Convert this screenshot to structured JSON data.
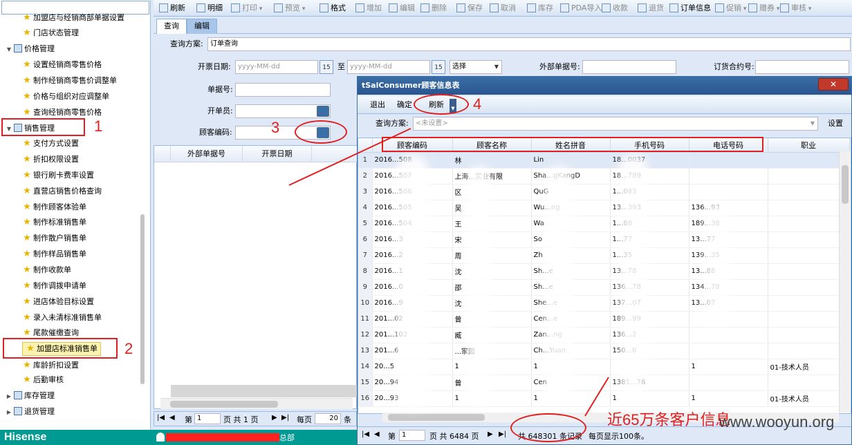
{
  "left_tree": {
    "items": [
      {
        "label": "加盟店与经销商部单据设置",
        "type": "star",
        "indent": 2
      },
      {
        "label": "门店状态管理",
        "type": "star",
        "indent": 2
      },
      {
        "label": "价格管理",
        "type": "group",
        "indent": 1
      },
      {
        "label": "设置经销商零售价格",
        "type": "star",
        "indent": 2
      },
      {
        "label": "制作经销商零售价调整单",
        "type": "star",
        "indent": 2
      },
      {
        "label": "价格与组织对应调整单",
        "type": "star",
        "indent": 2
      },
      {
        "label": "查询经销商零售价格",
        "type": "star",
        "indent": 2
      },
      {
        "label": "销售管理",
        "type": "group",
        "indent": 1
      },
      {
        "label": "支付方式设置",
        "type": "star",
        "indent": 2
      },
      {
        "label": "折扣权限设置",
        "type": "star",
        "indent": 2
      },
      {
        "label": "银行刷卡费率设置",
        "type": "star",
        "indent": 2
      },
      {
        "label": "直营店销售价格查询",
        "type": "star",
        "indent": 2
      },
      {
        "label": "制作顾客体验单",
        "type": "star",
        "indent": 2
      },
      {
        "label": "制作标准销售单",
        "type": "star",
        "indent": 2
      },
      {
        "label": "制作散户销售单",
        "type": "star",
        "indent": 2
      },
      {
        "label": "制作样品销售单",
        "type": "star",
        "indent": 2
      },
      {
        "label": "制作收款单",
        "type": "star",
        "indent": 2
      },
      {
        "label": "制作调拨申请单",
        "type": "star",
        "indent": 2
      },
      {
        "label": "进店体验目标设置",
        "type": "star",
        "indent": 2
      },
      {
        "label": "录入未清标准销售单",
        "type": "star",
        "indent": 2
      },
      {
        "label": "尾款催缴查询",
        "type": "star",
        "indent": 2
      },
      {
        "label": "加盟店标准销售单",
        "type": "star",
        "indent": 2,
        "selected": true
      },
      {
        "label": "库龄折扣设置",
        "type": "star",
        "indent": 2
      },
      {
        "label": "后勤审核",
        "type": "star",
        "indent": 2
      },
      {
        "label": "库存管理",
        "type": "group",
        "indent": 1,
        "collapsed": true
      },
      {
        "label": "退货管理",
        "type": "group",
        "indent": 1,
        "collapsed": true
      }
    ]
  },
  "brand": "Hisense",
  "status_user_suffix": "总部",
  "toolbar": {
    "items": [
      {
        "label": "刷新",
        "enabled": true
      },
      {
        "label": "明细",
        "enabled": true
      },
      {
        "label": "打印",
        "enabled": false,
        "dropdown": true
      },
      {
        "label": "预览",
        "enabled": false,
        "dropdown": true
      },
      {
        "label": "格式",
        "enabled": true
      },
      {
        "label": "增加",
        "enabled": false
      },
      {
        "label": "编辑",
        "enabled": false
      },
      {
        "label": "删除",
        "enabled": false
      },
      {
        "label": "保存",
        "enabled": false
      },
      {
        "label": "取消",
        "enabled": false
      },
      {
        "label": "库存",
        "enabled": false
      },
      {
        "label": "PDA导入",
        "enabled": false
      },
      {
        "label": "收款",
        "enabled": false
      },
      {
        "label": "退货",
        "enabled": false
      },
      {
        "label": "订单信息",
        "enabled": true
      },
      {
        "label": "促销",
        "enabled": false,
        "dropdown": true
      },
      {
        "label": "赠券",
        "enabled": false,
        "dropdown": true
      },
      {
        "label": "审核",
        "enabled": false,
        "dropdown": true
      }
    ]
  },
  "tabs": [
    {
      "label": "查询"
    },
    {
      "label": "编辑"
    }
  ],
  "form": {
    "scheme_label": "查询方案:",
    "scheme_value": "订单查询",
    "open_date_label": "开票日期:",
    "date_placeholder": "yyyy-MM-dd",
    "cal_icon_text": "15",
    "to_label": "至",
    "select_value": "选择",
    "ext_no_label": "外部单据号:",
    "contract_label": "订货合约号:",
    "doc_no_label": "单据号:",
    "issuer_label": "开单员:",
    "customer_code_label": "顾客编码:"
  },
  "left_grid": {
    "headers": [
      "外部单据号",
      "开票日期"
    ]
  },
  "left_pager": {
    "page_prefix": "第",
    "page_value": "1",
    "page_suffix": "页 共 1 页",
    "per_page_label": "每页",
    "per_page_value": "20",
    "per_page_unit": "条"
  },
  "dialog": {
    "title": "tSalConsumer顾客信息表",
    "close_symbol": "✕",
    "toolbar": [
      "退出",
      "确定",
      "刷新"
    ],
    "scheme_label": "查询方案:",
    "scheme_placeholder": "<未设置>",
    "settings_button": "设置",
    "columns": [
      "顾客编码",
      "顾客名称",
      "姓名拼音",
      "手机号码",
      "电话号码",
      "职业"
    ],
    "rows": [
      [
        "2016...508",
        "林",
        "Lin",
        "18...0037",
        "",
        ""
      ],
      [
        "2016...507",
        "上海...实业有限",
        "Sha...gKangD",
        "18...789",
        "",
        ""
      ],
      [
        "2016...506",
        "区",
        "QuG",
        "1...083",
        "",
        ""
      ],
      [
        "2016...505",
        "吴",
        "Wu...ng",
        "13...393",
        "136...93",
        ""
      ],
      [
        "2016...504",
        "王",
        "Wa",
        "1...88",
        "189...38",
        ""
      ],
      [
        "2016...3",
        "宋",
        "So",
        "1...77",
        "13...77",
        ""
      ],
      [
        "2016...2",
        "周",
        "Zh",
        "1...35",
        "139...35",
        ""
      ],
      [
        "2016...1",
        "沈",
        "Sh...e",
        "13...78",
        "13...88",
        ""
      ],
      [
        "2016...0",
        "邵",
        "Sh...e",
        "136...78",
        "134...78",
        ""
      ],
      [
        "2016...9",
        "沈",
        "She...e",
        "137...07",
        "13...07",
        ""
      ],
      [
        "201...02",
        "曾",
        "Cen...e",
        "189...99",
        "",
        ""
      ],
      [
        "201...102",
        "臧",
        "Zan...ng",
        "136...2",
        "",
        ""
      ],
      [
        "201...6",
        "...家园",
        "Ch...Yuan",
        "150...0",
        "",
        ""
      ],
      [
        "20...5",
        "1",
        "1",
        "",
        "1",
        "01-技术人员"
      ],
      [
        "20...94",
        "曾",
        "Cen",
        "1381...76",
        "",
        ""
      ],
      [
        "20...93",
        "1",
        "1",
        "1",
        "1",
        "01-技术人员"
      ]
    ],
    "pager": {
      "page_prefix": "第",
      "page_value": "1",
      "page_suffix": "页 共 6484 页",
      "total_text": "共 648301 条记录",
      "per_page_text": "每页显示100条。"
    }
  },
  "annotations": {
    "numbers": [
      "1",
      "2",
      "3",
      "4"
    ],
    "caption": "近65万条客户信息",
    "watermark": "www.wooyun.org",
    "color": "#e02020"
  }
}
